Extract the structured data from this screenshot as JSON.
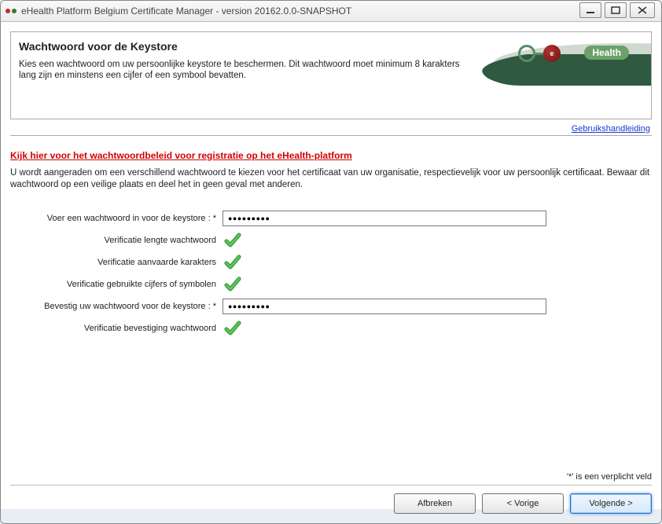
{
  "window": {
    "title": "eHealth Platform Belgium Certificate Manager - version 20162.0.0-SNAPSHOT"
  },
  "header": {
    "title": "Wachtwoord voor de Keystore",
    "description": "Kies een wachtwoord om uw persoonlijke keystore te beschermen. Dit wachtwoord moet minimum 8 karakters lang zijn en minstens een cijfer of een symbool bevatten.",
    "logo_text": "Health",
    "logo_badge": "e"
  },
  "links": {
    "guide": "Gebruikshandleiding",
    "policy": "Kijk hier voor het wachtwoordbeleid voor registratie op het eHealth-platform"
  },
  "policy_text": "U wordt aangeraden om een verschillend wachtwoord te kiezen voor het certificaat van uw organisatie, respectievelijk voor uw persoonlijk certificaat. Bewaar dit wachtwoord op een veilige plaats en deel het in geen geval met anderen.",
  "form": {
    "password_label": "Voer een wachtwoord in voor de keystore : *",
    "password_value": "●●●●●●●●●",
    "v_length": "Verificatie lengte wachtwoord",
    "v_chars": "Verificatie aanvaarde karakters",
    "v_symbols": "Verificatie gebruikte cijfers of symbolen",
    "confirm_label": "Bevestig uw wachtwoord voor de keystore : *",
    "confirm_value": "●●●●●●●●●",
    "v_confirm": "Verificatie bevestiging wachtwoord"
  },
  "footer": {
    "required_note": "'*' is een verplicht veld",
    "abort": "Afbreken",
    "back": "< Vorige",
    "next": "Volgende >"
  }
}
